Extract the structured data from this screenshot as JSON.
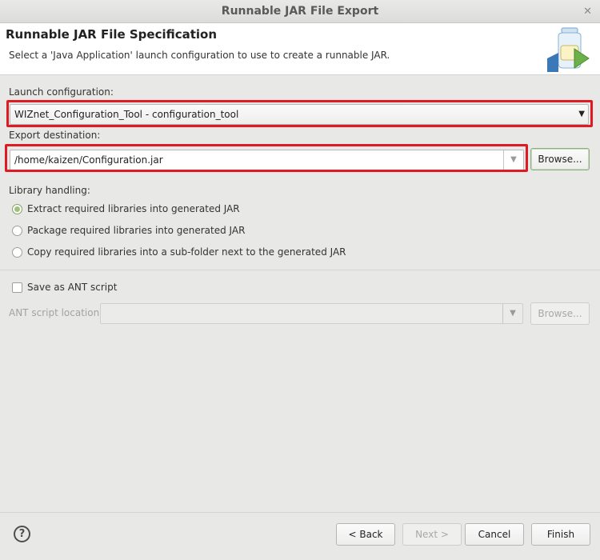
{
  "window": {
    "title": "Runnable JAR File Export",
    "close_glyph": "✕"
  },
  "header": {
    "title": "Runnable JAR File Specification",
    "description": "Select a 'Java Application' launch configuration to use to create a runnable JAR.",
    "icon": "jar-export-icon"
  },
  "launch": {
    "label": "Launch configuration:",
    "value": "WIZnet_Configuration_Tool - configuration_tool"
  },
  "export": {
    "label": "Export destination:",
    "value": "/home/kaizen/Configuration.jar",
    "browse_label": "Browse..."
  },
  "library": {
    "label": "Library handling:",
    "options": [
      {
        "label": "Extract required libraries into generated JAR",
        "checked": true
      },
      {
        "label": "Package required libraries into generated JAR",
        "checked": false
      },
      {
        "label": "Copy required libraries into a sub-folder next to the generated JAR",
        "checked": false
      }
    ]
  },
  "ant": {
    "checkbox_label": "Save as ANT script",
    "checked": false,
    "location_label": "ANT script location:",
    "location_value": "",
    "browse_label": "Browse..."
  },
  "footer": {
    "help_glyph": "?",
    "back_label": "< Back",
    "next_label": "Next >",
    "cancel_label": "Cancel",
    "finish_label": "Finish"
  },
  "colors": {
    "highlight": "#e01a22",
    "radio_checked": "#9ec27d"
  }
}
